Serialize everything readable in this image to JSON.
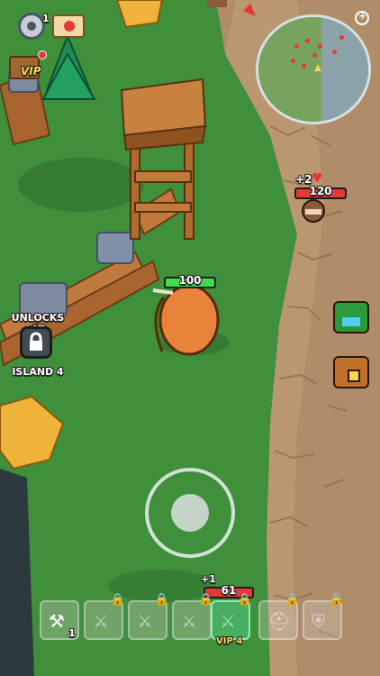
{
  "hud": {
    "settings_badge": "1",
    "vip_label": "VIP"
  },
  "minimap": {
    "zoom_icon": "magnify-plus-icon"
  },
  "player": {
    "health": "100"
  },
  "enemy": {
    "bonus": "+2",
    "health": "120"
  },
  "side_buttons": [
    {
      "icon": "shop-icon"
    },
    {
      "icon": "chest-icon"
    }
  ],
  "unlock": {
    "line1": "UNLOCKS AT",
    "line2": "ISLAND 4"
  },
  "hotbar": {
    "slots": [
      {
        "icon": "axe-icon",
        "count": "1",
        "locked": false
      },
      {
        "icon": "sword-icon",
        "locked": true
      },
      {
        "icon": "sword-icon",
        "locked": true
      },
      {
        "icon": "sword-icon",
        "locked": true
      },
      {
        "icon": "sword-icon",
        "locked": true,
        "active": true,
        "caption": "VIP 4"
      },
      {
        "icon": "helmet-icon",
        "locked": true
      },
      {
        "icon": "shield-icon",
        "locked": true
      }
    ],
    "active_bonus": "+1",
    "active_value": "61"
  },
  "colors": {
    "health_green": "#3ddc4a",
    "health_red": "#e53935",
    "path": "#b8946a",
    "grass": "#3d8b3a"
  }
}
